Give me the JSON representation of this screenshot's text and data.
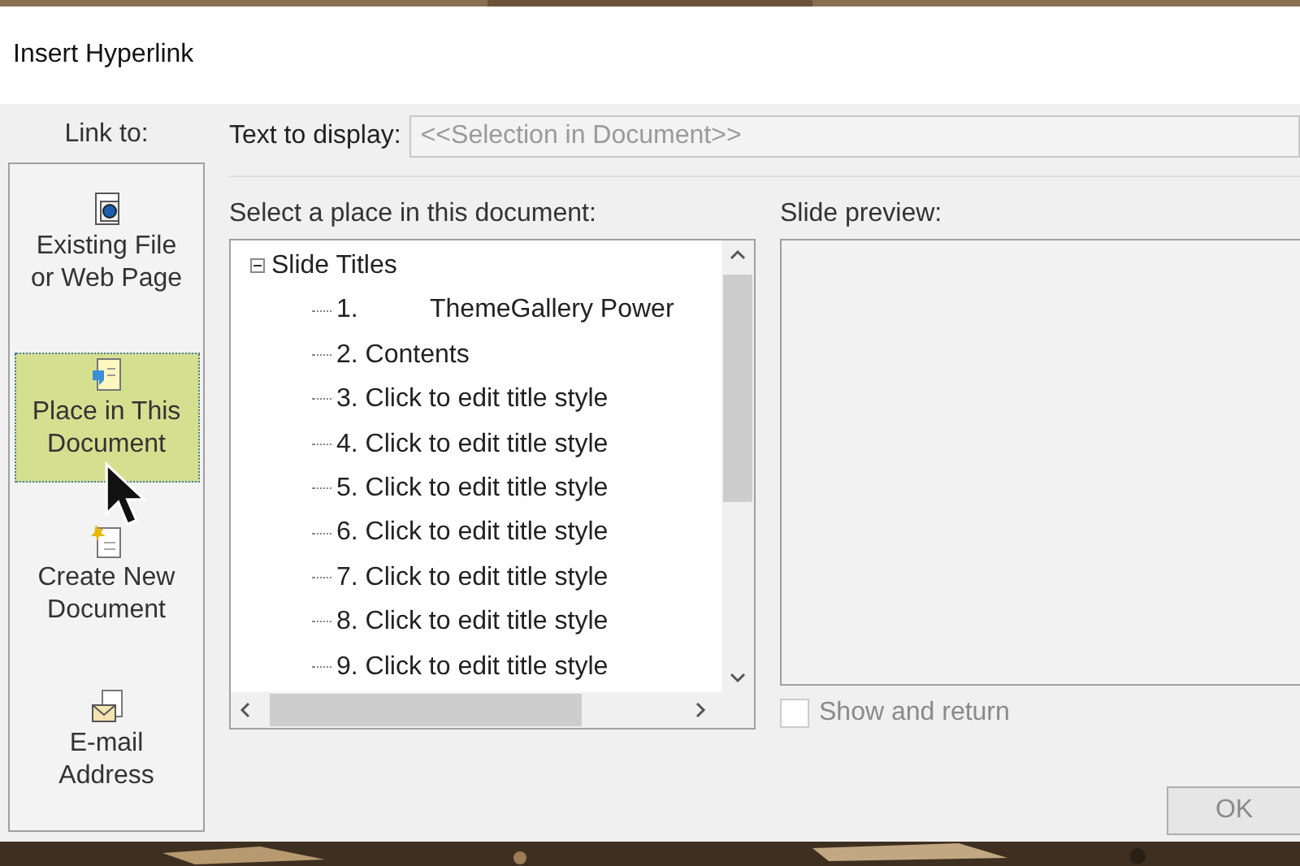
{
  "window": {
    "title": "Insert Hyperlink"
  },
  "link_to": {
    "label": "Link to:",
    "items": [
      {
        "kind": "file",
        "label": "Existing File or Web Page",
        "selected": false
      },
      {
        "kind": "place",
        "label": "Place in This Document",
        "selected": true
      },
      {
        "kind": "new",
        "label": "Create New Document",
        "selected": false
      },
      {
        "kind": "email",
        "label": "E-mail Address",
        "selected": false
      }
    ]
  },
  "text_to_display": {
    "label": "Text to display:",
    "value": "<<Selection in Document>>"
  },
  "place_tree": {
    "label": "Select a place in this document:",
    "items": [
      {
        "label": "Slide Titles",
        "expanded": true,
        "children": [
          {
            "label": "1.          ThemeGallery Power"
          },
          {
            "label": "2. Contents"
          },
          {
            "label": "3. Click to edit title style"
          },
          {
            "label": "4. Click to edit title style"
          },
          {
            "label": "5. Click to edit title style"
          },
          {
            "label": "6. Click to edit title style"
          },
          {
            "label": "7. Click to edit title style"
          },
          {
            "label": "8. Click to edit title style"
          },
          {
            "label": "9. Click to edit title style"
          }
        ]
      }
    ]
  },
  "slide_preview": {
    "label": "Slide preview:"
  },
  "show_and_return": {
    "label": "Show and return",
    "checked": false,
    "disabled": true
  },
  "buttons": [
    "OK"
  ]
}
